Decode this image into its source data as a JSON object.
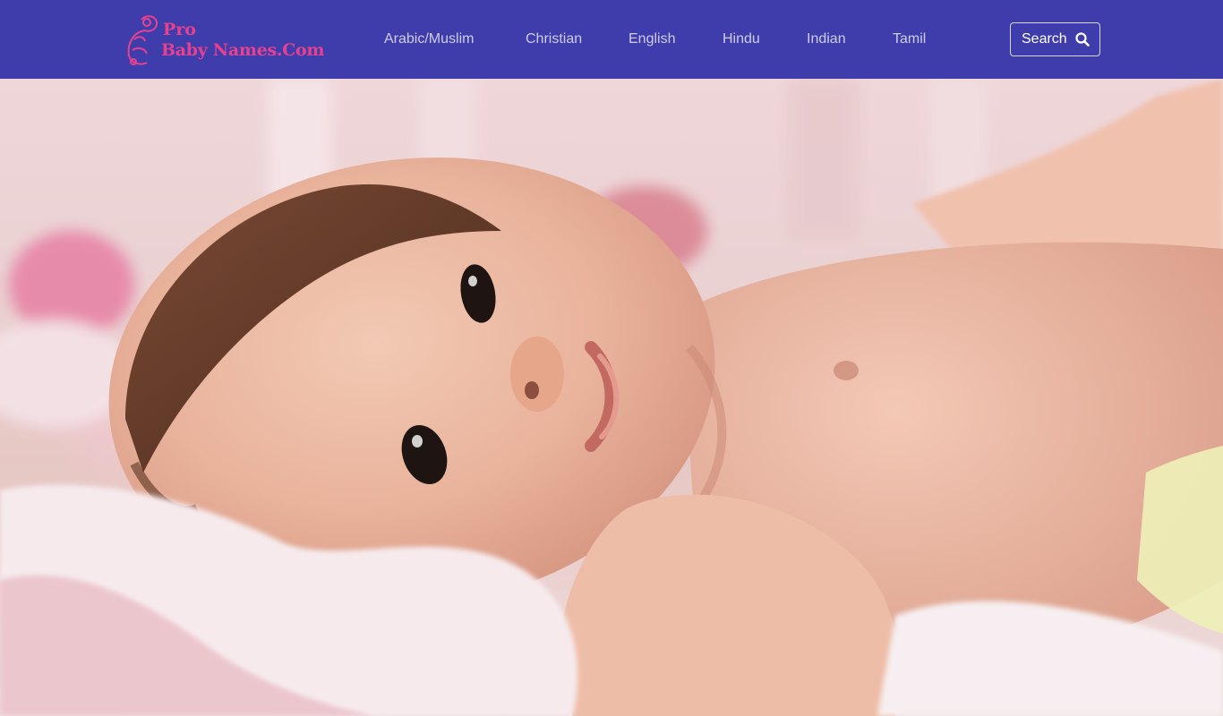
{
  "site": {
    "logo_line1": "Pro",
    "logo_line2": "Baby Names.Com",
    "logo_icon": "baby-stroller-logo-icon"
  },
  "nav": {
    "items": [
      {
        "label": "Arabic/Muslim"
      },
      {
        "label": "Christian"
      },
      {
        "label": "English"
      },
      {
        "label": "Hindu"
      },
      {
        "label": "Indian"
      },
      {
        "label": "Tamil"
      }
    ],
    "search_label": "Search",
    "search_icon": "search-icon"
  },
  "hero": {
    "image": "baby-lying-photo"
  },
  "colors": {
    "navbar": "#3f3dab",
    "logo": "#e6418f",
    "nav_text": "#cfcbe8",
    "search_text": "#ffffff"
  }
}
